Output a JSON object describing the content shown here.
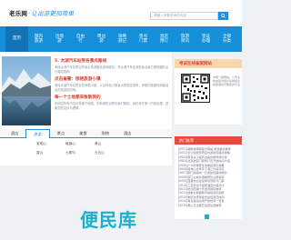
{
  "header": {
    "logo_title": "老乐网",
    "logo_slogan": "让出游更加简单",
    "search_placeholder": "请输入你要查询的内容"
  },
  "nav": {
    "items": [
      {
        "label": "首页"
      },
      {
        "label": "国内\n旅游"
      },
      {
        "label": "出境\n游"
      },
      {
        "label": "自由\n行"
      },
      {
        "label": "周边\n游"
      },
      {
        "label": "攻略\n游记"
      },
      {
        "label": "景点\n门票"
      },
      {
        "label": "酒店\n预订"
      },
      {
        "label": "旅游\n资讯"
      },
      {
        "label": "签证\n办理"
      },
      {
        "label": "全部\n分类"
      }
    ]
  },
  "featured": {
    "title_1": "5. 太湖汽车站到各景点路线",
    "text_1": "承接太湖汽车站附近的景点旅游路线咨询服务，是太湖汽车站到各景点最方便快捷的出行路线推荐。",
    "title_2": "点击查看：惊艳旅游小镇",
    "text_2": "承接太湖汽车站附近的惊艳小镇，以及特色小镇景点的旅游推荐，帮助你快速找到最适合的旅游目的地。",
    "title_3": "每一个土地都来致敬我的",
    "text_3": "本网站所有内容均来源于网络，如有侵权请联系我们删除，我们将在第一时间处理，感谢您的支持与理解。"
  },
  "tabs": {
    "items": [
      "酒店",
      "旅游",
      "景点",
      "美食",
      "购物",
      "酒店"
    ],
    "active_index": 1,
    "links": [
      "宝塔山",
      "峨眉山",
      "黄山",
      "香山",
      "九寨沟",
      "长白山"
    ]
  },
  "sidebar": {
    "qr_title": "考试在线备案网站",
    "qr_note": "中国一级网站、以专业的态度为用户提供最全的旅游资讯服务的平台",
    "hot_title": "热门推荐",
    "hot_items": [
      "[0001]湖南旅游网官方网站 旅游路线推荐",
      "[0002]长沙到张家界自驾游最佳路线攻略",
      "[0003]南京夫子庙周边美食推荐排行榜",
      "[0004]北京故宫门票预订及开放时间介绍",
      "[0005]广州长隆野生动物园游玩攻略",
      "[0006]桂林山水甲天下漓江竹筏漂流",
      "[0007]厦门鼓浪屿一日游最佳路线规划",
      "[0008]丽江古城住宿推荐及注意事项",
      "[0009]西藏布达拉宫参观须知与门票",
      "[0010]三亚亚龙湾度假酒店价格对比",
      "[0011]杭州西湖十景游览顺序推荐",
      "[0012]成都大熊猫繁育基地游玩指南",
      "[0013]重庆洪崖洞夜景最佳观赏时间",
      "[0014]青岛海边浴场开放时间一览表",
      "[0015]黄山日出观赏最佳位置推荐"
    ]
  },
  "watermark": "便民库",
  "colors": {
    "brand_blue": "#148fd8",
    "accent_red": "#d93a2c",
    "hot_red": "#e84a3c",
    "watermark_teal": "#17b1ce"
  }
}
